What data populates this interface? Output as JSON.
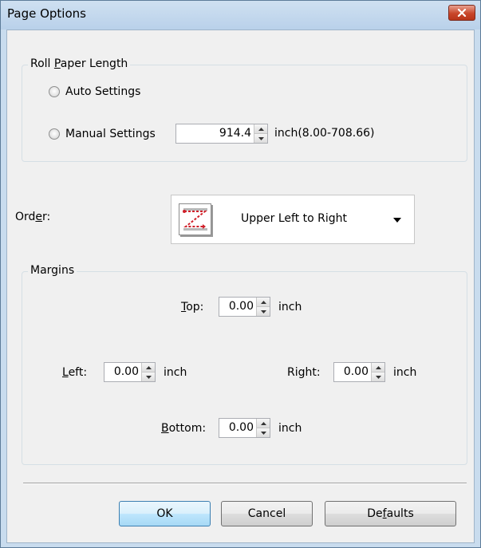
{
  "window": {
    "title": "Page Options"
  },
  "roll_paper": {
    "group_label_pre": "Roll ",
    "group_label_key": "P",
    "group_label_post": "aper Length",
    "auto_label": "Auto Settings",
    "manual_label": "Manual Settings",
    "length_value": "914.4",
    "unit_range": "inch(8.00-708.66)"
  },
  "order": {
    "label_pre": "Ord",
    "label_key": "e",
    "label_post": "r:",
    "selected": "Upper Left to Right",
    "icon": "z-order-icon"
  },
  "margins": {
    "group_label": "Margins",
    "top": {
      "label_key": "T",
      "label_post": "op:",
      "value": "0.00",
      "unit": "inch"
    },
    "left": {
      "label_key": "L",
      "label_post": "eft:",
      "value": "0.00",
      "unit": "inch"
    },
    "right": {
      "label_pre": "Right:",
      "value": "0.00",
      "unit": "inch"
    },
    "bottom": {
      "label_key": "B",
      "label_post": "ottom:",
      "value": "0.00",
      "unit": "inch"
    }
  },
  "buttons": {
    "ok": "OK",
    "cancel": "Cancel",
    "defaults_pre": "De",
    "defaults_key": "f",
    "defaults_post": "aults"
  },
  "colors": {
    "titlebar": "#b9d1ea",
    "close": "#c8462a",
    "dialog_bg": "#f0f0f0",
    "default_button": "#bee6fd"
  }
}
